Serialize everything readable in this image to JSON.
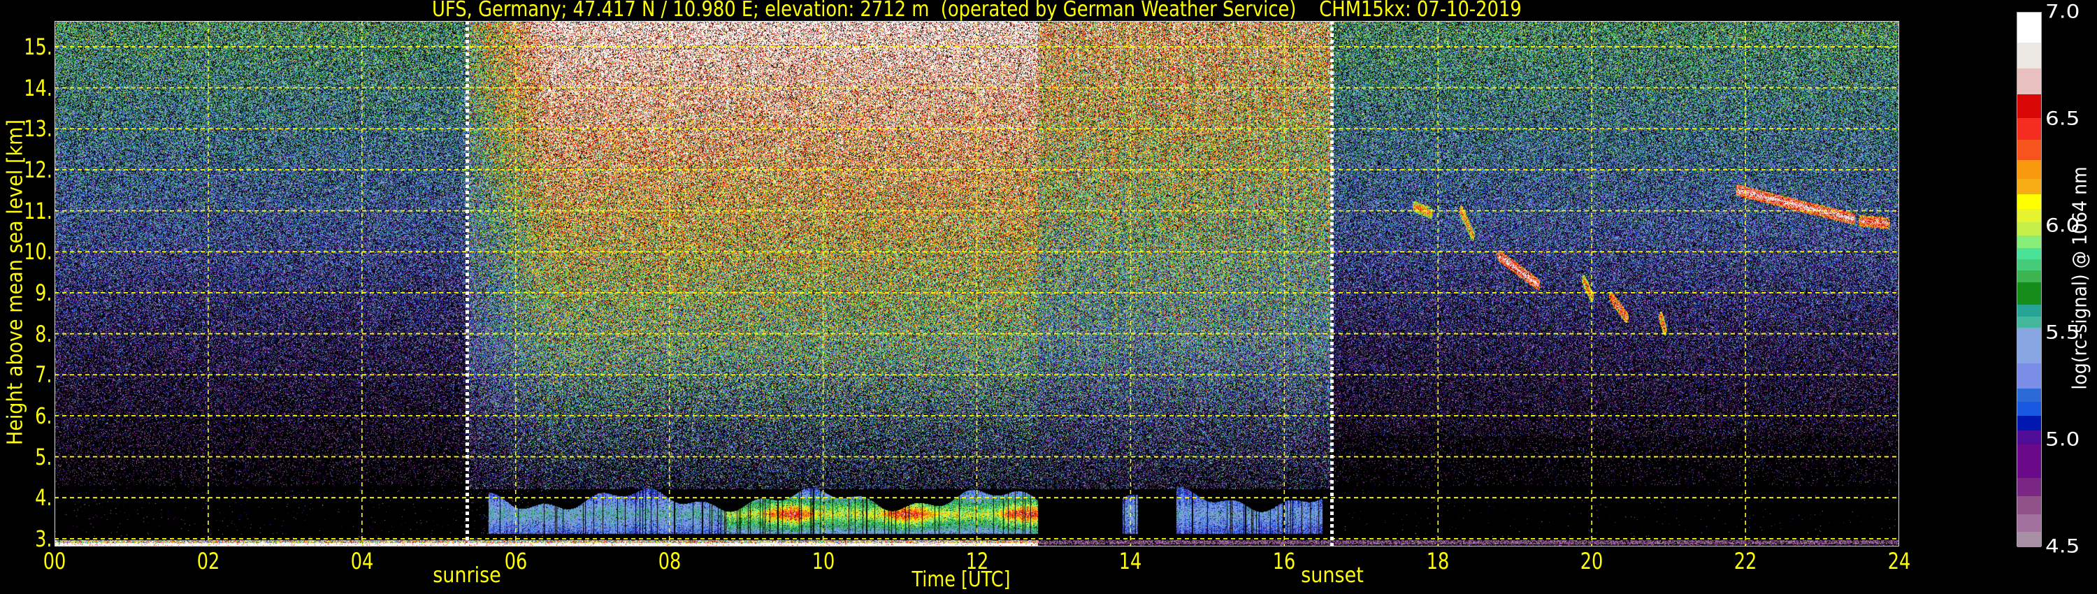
{
  "chart_data": {
    "type": "heatmap",
    "title": "UFS, Germany; 47.417 N / 10.980 E; elevation: 2712 m  (operated by German Weather Service)    CHM15kx: 07-10-2019",
    "xlabel": "Time [UTC]",
    "ylabel": "Height above mean sea level [km]",
    "xlim": [
      0,
      24
    ],
    "ylim": [
      2.81,
      15.63
    ],
    "x_ticks": [
      0,
      2,
      4,
      6,
      8,
      10,
      12,
      14,
      16,
      18,
      20,
      22,
      24
    ],
    "x_tick_labels": [
      "00",
      "02",
      "04",
      "06",
      "08",
      "10",
      "12",
      "14",
      "16",
      "18",
      "20",
      "22",
      "24"
    ],
    "y_ticks": [
      3,
      4,
      5,
      6,
      7,
      8,
      9,
      10,
      11,
      12,
      13,
      14,
      15
    ],
    "y_tick_labels": [
      "3.",
      "4.",
      "5.",
      "6.",
      "7.",
      "8.",
      "9.",
      "10.",
      "11.",
      "12.",
      "13.",
      "14.",
      "15."
    ],
    "grid": true,
    "markers": [
      {
        "label": "sunrise",
        "time": 5.37
      },
      {
        "label": "sunset",
        "time": 16.62
      }
    ],
    "colorbar": {
      "label": "log(rc-signal) @ 1064 nm",
      "range": [
        4.5,
        7.0
      ],
      "tick_values": [
        7.0,
        6.5,
        6.0,
        5.5,
        5.0,
        4.5
      ],
      "tick_labels": [
        "7.0",
        "6.5",
        "6.0",
        "5.5",
        "5.0",
        "4.5"
      ],
      "levels": [
        7.0,
        6.861,
        6.738,
        6.618,
        6.507,
        6.404,
        6.312,
        6.223,
        6.15,
        6.082,
        6.02,
        5.959,
        5.9,
        5.848,
        5.795,
        5.739,
        5.634,
        5.577,
        5.525,
        5.361,
        5.241,
        5.179,
        5.116,
        5.046,
        4.979,
        4.823,
        4.738,
        4.652,
        4.573,
        4.5
      ],
      "colors": [
        "#ffffff",
        "#ece8e4",
        "#e8c0c0",
        "#d90606",
        "#f52d20",
        "#f6541c",
        "#f8980c",
        "#f6ac14",
        "#ffff00",
        "#e6f430",
        "#c6ee48",
        "#88ee7a",
        "#4ae296",
        "#44cc7a",
        "#3cb450",
        "#168c1a",
        "#26a496",
        "#44b89c",
        "#88a6e2",
        "#7a8ee8",
        "#2c6ad8",
        "#1858e0",
        "#0018b0",
        "#4e0c98",
        "#6a0a8a",
        "#7a2684",
        "#905288",
        "#a2709c",
        "#a890a4"
      ]
    },
    "boundary_layer": {
      "start": 5.65,
      "end": 12.8,
      "strong_from": 8.7,
      "base_km": 3.12,
      "top_km": 4.1
    },
    "cloud_features": [
      {
        "t": [
          17.7,
          17.9
        ],
        "h": [
          11.1,
          10.95
        ],
        "v": 6.1
      },
      {
        "t": [
          18.3,
          18.45
        ],
        "h": [
          11.0,
          10.4
        ],
        "v": 6.1
      },
      {
        "t": [
          18.8,
          19.3
        ],
        "h": [
          9.9,
          9.2
        ],
        "v": 6.5
      },
      {
        "t": [
          19.9,
          20.0
        ],
        "h": [
          9.3,
          8.9
        ],
        "v": 6.1
      },
      {
        "t": [
          20.25,
          20.45
        ],
        "h": [
          8.9,
          8.4
        ],
        "v": 6.3
      },
      {
        "t": [
          20.9,
          20.95
        ],
        "h": [
          8.4,
          8.1
        ],
        "v": 6.2
      },
      {
        "t": [
          21.9,
          23.4
        ],
        "h": [
          11.5,
          10.8
        ],
        "v": 6.5
      },
      {
        "t": [
          23.5,
          23.85
        ],
        "h": [
          10.75,
          10.7
        ],
        "v": 6.4
      }
    ],
    "colors": {
      "text": "#ffff00",
      "grid": "#ffff00",
      "marker": "#ffffff"
    }
  }
}
